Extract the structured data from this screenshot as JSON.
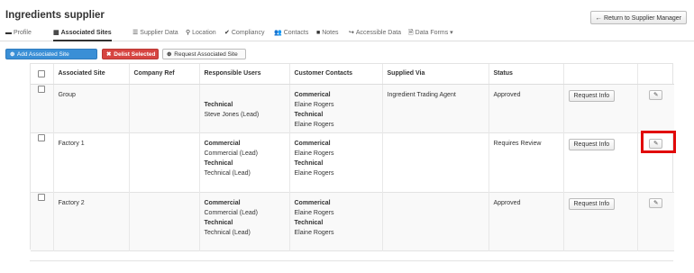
{
  "page": {
    "title": "Ingredients supplier",
    "return_label": "Return to Supplier Manager"
  },
  "tabs": [
    {
      "icon": "▬",
      "label": "Profile"
    },
    {
      "icon": "▦",
      "label": "Associated Sites"
    },
    {
      "icon": "☰",
      "label": "Supplier Data"
    },
    {
      "icon": "⚲",
      "label": "Location"
    },
    {
      "icon": "✔",
      "label": "Compliancy"
    },
    {
      "icon": "👥",
      "label": "Contacts"
    },
    {
      "icon": "■",
      "label": "Notes"
    },
    {
      "icon": "↪",
      "label": "Accessible Data"
    },
    {
      "icon": "🗎",
      "label": "Data Forms ▾"
    }
  ],
  "actions": {
    "add_label": "Add Associated Site",
    "delist_label": "Delist Selected",
    "request_label": "Request Associated Site"
  },
  "table": {
    "headers": [
      "Associated Site",
      "Company Ref",
      "Responsible Users",
      "Customer Contacts",
      "Supplied Via",
      "Status"
    ],
    "rows": [
      {
        "site": "Group",
        "company_ref": "",
        "responsible": [
          {
            "text": "",
            "bold": false
          },
          {
            "text": "Technical",
            "bold": true
          },
          {
            "text": "Steve Jones (Lead)",
            "bold": false
          }
        ],
        "contacts": [
          {
            "text": "Commerical",
            "bold": true
          },
          {
            "text": "Elaine Rogers",
            "bold": false
          },
          {
            "text": "Technical",
            "bold": true
          },
          {
            "text": "Elaine Rogers",
            "bold": false
          }
        ],
        "supplied_via": "Ingredient Trading Agent",
        "status": "Approved",
        "request_info": "Request Info"
      },
      {
        "site": "Factory 1",
        "company_ref": "",
        "responsible": [
          {
            "text": "Commercial",
            "bold": true
          },
          {
            "text": "Commercial (Lead)",
            "bold": false
          },
          {
            "text": "Technical",
            "bold": true
          },
          {
            "text": "Technical (Lead)",
            "bold": false
          }
        ],
        "contacts": [
          {
            "text": "Commerical",
            "bold": true
          },
          {
            "text": "Elaine Rogers",
            "bold": false
          },
          {
            "text": "Technical",
            "bold": true
          },
          {
            "text": "Elaine Rogers",
            "bold": false
          }
        ],
        "supplied_via": "",
        "status": "Requires Review",
        "request_info": "Request Info"
      },
      {
        "site": "Factory 2",
        "company_ref": "",
        "responsible": [
          {
            "text": "Commercial",
            "bold": true
          },
          {
            "text": "Commercial (Lead)",
            "bold": false
          },
          {
            "text": "Technical",
            "bold": true
          },
          {
            "text": "Technical (Lead)",
            "bold": false
          }
        ],
        "contacts": [
          {
            "text": "Commerical",
            "bold": true
          },
          {
            "text": "Elaine Rogers",
            "bold": false
          },
          {
            "text": "Technical",
            "bold": true
          },
          {
            "text": "Elaine Rogers",
            "bold": false
          }
        ],
        "supplied_via": "",
        "status": "Approved",
        "request_info": "Request Info"
      }
    ]
  },
  "colors": {
    "add_button": "#3a8fd6",
    "delist_button": "#d64541",
    "highlight": "#e10a0a"
  }
}
